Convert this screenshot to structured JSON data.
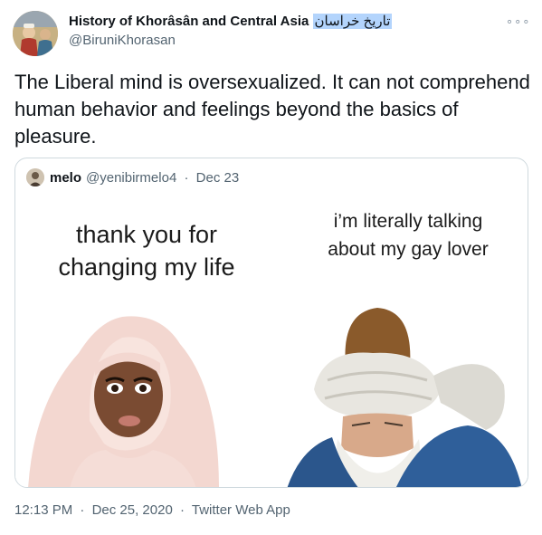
{
  "author": {
    "display_name": "History of Khorâsân and Central Asia",
    "display_name_arabic": "تاریخ خراسان",
    "handle": "@BiruniKhorasan",
    "more_glyph": "∘∘∘"
  },
  "tweet": {
    "text": "The Liberal mind is oversexualized. It can not comprehend human behavior and feelings beyond the basics of pleasure."
  },
  "quoted_tweet": {
    "display_name": "melo",
    "handle": "@yenibirmelo4",
    "separator": "·",
    "date": "Dec 23",
    "meme": {
      "left_caption_line1": "thank you for",
      "left_caption_line2": "changing my life",
      "right_caption_line1": "i’m literally talking",
      "right_caption_line2": "about my gay lover"
    }
  },
  "footer": {
    "time": "12:13 PM",
    "separator": "·",
    "date": "Dec 25, 2020",
    "source": "Twitter Web App"
  },
  "colors": {
    "text_primary": "#0f1419",
    "text_secondary": "#536471",
    "border": "#cfd9de",
    "highlight": "#b3d4fc"
  },
  "icons": {
    "more": "more-dots-icon"
  }
}
